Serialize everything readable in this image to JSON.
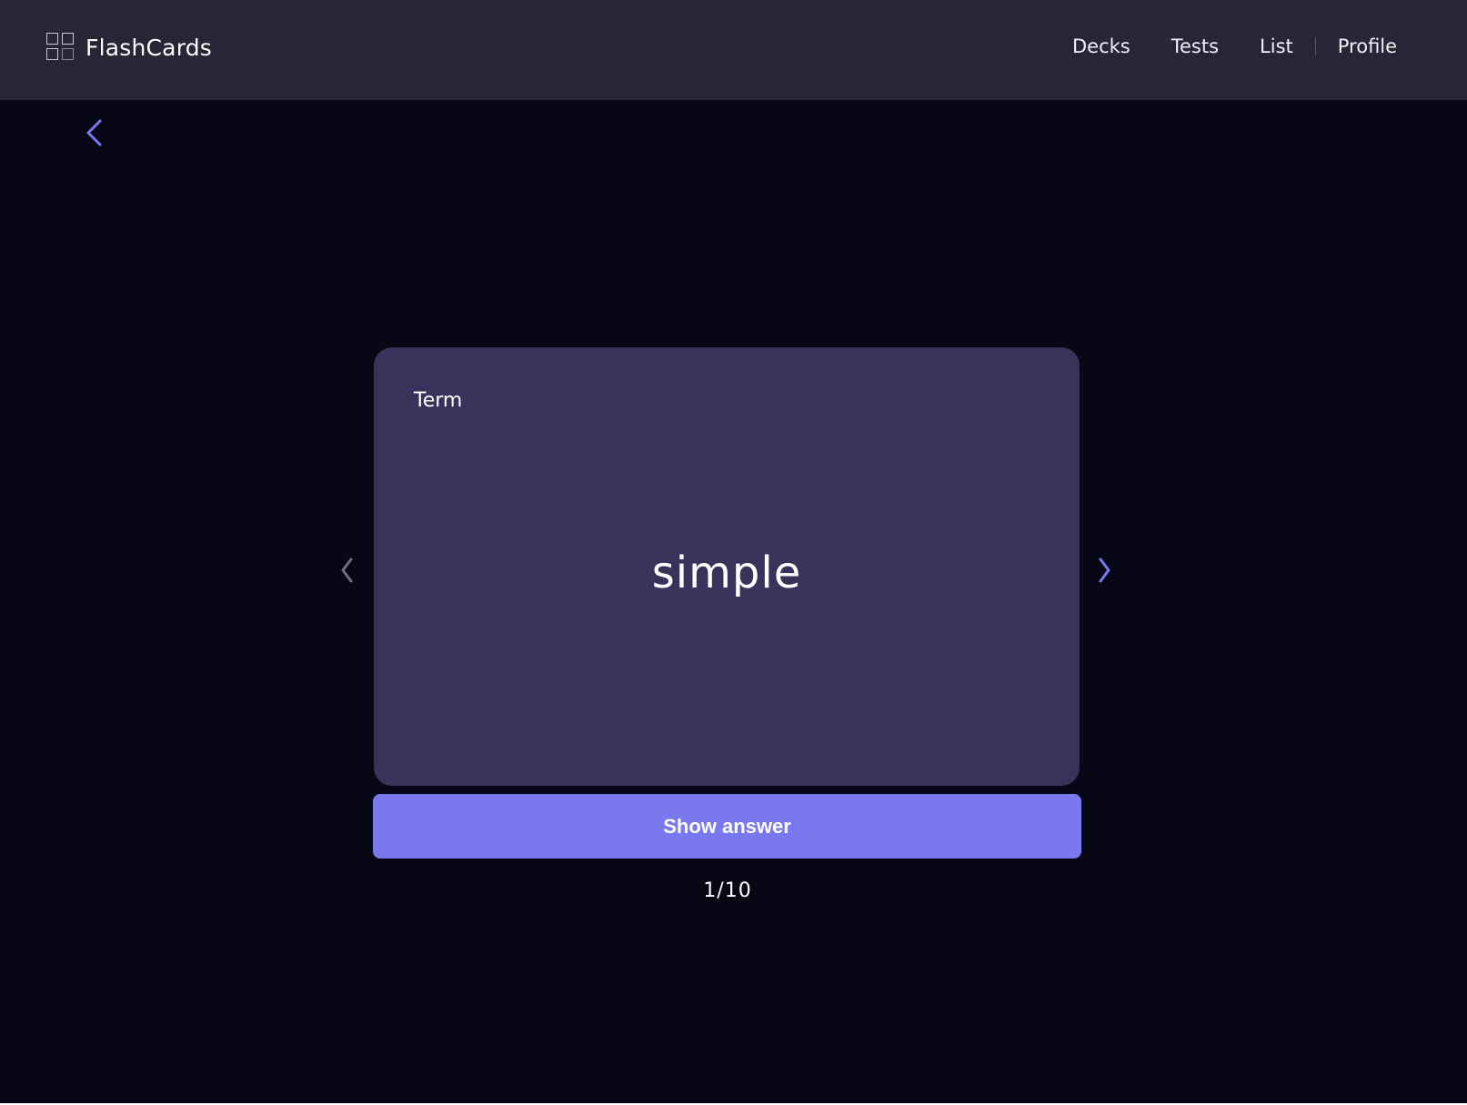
{
  "app": {
    "name": "FlashCards",
    "logo_icon": "grid-icon"
  },
  "nav": {
    "items": [
      {
        "label": "Decks"
      },
      {
        "label": "Tests"
      },
      {
        "label": "List"
      },
      {
        "label": "Profile"
      }
    ]
  },
  "back": {
    "icon": "chevron-left-icon",
    "color": "#7a78ee"
  },
  "card": {
    "label": "Term",
    "term": "simple",
    "background": "#38335a"
  },
  "controls": {
    "prev_icon": "chevron-left-icon",
    "next_icon": "chevron-right-icon",
    "show_answer_label": "Show answer",
    "accent": "#7a78ee"
  },
  "progress": {
    "text": "1/10",
    "current": 1,
    "total": 10
  }
}
